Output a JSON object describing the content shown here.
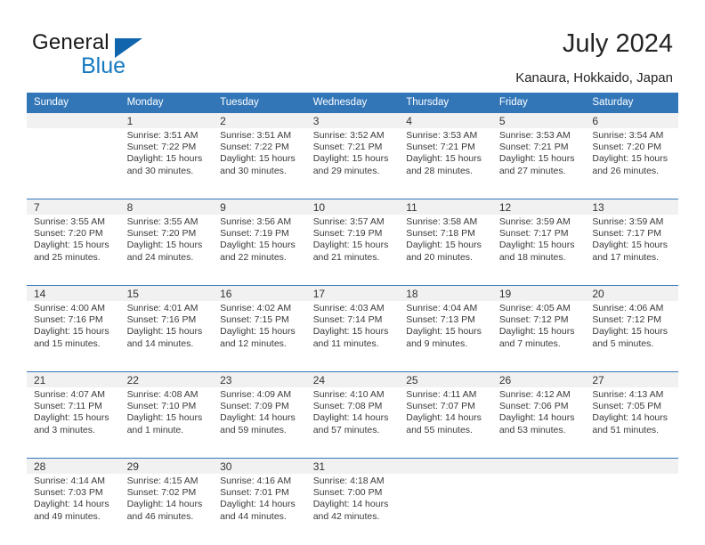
{
  "brand": {
    "name_top": "General",
    "name_bottom": "Blue",
    "accent_color": "#1579c0",
    "triangle_color": "#1165ad"
  },
  "header": {
    "title": "July 2024",
    "subtitle": "Kanaura, Hokkaido, Japan"
  },
  "theme": {
    "header_blue": "#3276b8",
    "daynum_band": "#f1f1f1",
    "text": "#3a3a3a"
  },
  "calendar": {
    "weekday_headers": [
      "Sunday",
      "Monday",
      "Tuesday",
      "Wednesday",
      "Thursday",
      "Friday",
      "Saturday"
    ],
    "weeks": [
      [
        {
          "day": "",
          "info": ""
        },
        {
          "day": "1",
          "info": "Sunrise: 3:51 AM\nSunset: 7:22 PM\nDaylight: 15 hours and 30 minutes."
        },
        {
          "day": "2",
          "info": "Sunrise: 3:51 AM\nSunset: 7:22 PM\nDaylight: 15 hours and 30 minutes."
        },
        {
          "day": "3",
          "info": "Sunrise: 3:52 AM\nSunset: 7:21 PM\nDaylight: 15 hours and 29 minutes."
        },
        {
          "day": "4",
          "info": "Sunrise: 3:53 AM\nSunset: 7:21 PM\nDaylight: 15 hours and 28 minutes."
        },
        {
          "day": "5",
          "info": "Sunrise: 3:53 AM\nSunset: 7:21 PM\nDaylight: 15 hours and 27 minutes."
        },
        {
          "day": "6",
          "info": "Sunrise: 3:54 AM\nSunset: 7:20 PM\nDaylight: 15 hours and 26 minutes."
        }
      ],
      [
        {
          "day": "7",
          "info": "Sunrise: 3:55 AM\nSunset: 7:20 PM\nDaylight: 15 hours and 25 minutes."
        },
        {
          "day": "8",
          "info": "Sunrise: 3:55 AM\nSunset: 7:20 PM\nDaylight: 15 hours and 24 minutes."
        },
        {
          "day": "9",
          "info": "Sunrise: 3:56 AM\nSunset: 7:19 PM\nDaylight: 15 hours and 22 minutes."
        },
        {
          "day": "10",
          "info": "Sunrise: 3:57 AM\nSunset: 7:19 PM\nDaylight: 15 hours and 21 minutes."
        },
        {
          "day": "11",
          "info": "Sunrise: 3:58 AM\nSunset: 7:18 PM\nDaylight: 15 hours and 20 minutes."
        },
        {
          "day": "12",
          "info": "Sunrise: 3:59 AM\nSunset: 7:17 PM\nDaylight: 15 hours and 18 minutes."
        },
        {
          "day": "13",
          "info": "Sunrise: 3:59 AM\nSunset: 7:17 PM\nDaylight: 15 hours and 17 minutes."
        }
      ],
      [
        {
          "day": "14",
          "info": "Sunrise: 4:00 AM\nSunset: 7:16 PM\nDaylight: 15 hours and 15 minutes."
        },
        {
          "day": "15",
          "info": "Sunrise: 4:01 AM\nSunset: 7:16 PM\nDaylight: 15 hours and 14 minutes."
        },
        {
          "day": "16",
          "info": "Sunrise: 4:02 AM\nSunset: 7:15 PM\nDaylight: 15 hours and 12 minutes."
        },
        {
          "day": "17",
          "info": "Sunrise: 4:03 AM\nSunset: 7:14 PM\nDaylight: 15 hours and 11 minutes."
        },
        {
          "day": "18",
          "info": "Sunrise: 4:04 AM\nSunset: 7:13 PM\nDaylight: 15 hours and 9 minutes."
        },
        {
          "day": "19",
          "info": "Sunrise: 4:05 AM\nSunset: 7:12 PM\nDaylight: 15 hours and 7 minutes."
        },
        {
          "day": "20",
          "info": "Sunrise: 4:06 AM\nSunset: 7:12 PM\nDaylight: 15 hours and 5 minutes."
        }
      ],
      [
        {
          "day": "21",
          "info": "Sunrise: 4:07 AM\nSunset: 7:11 PM\nDaylight: 15 hours and 3 minutes."
        },
        {
          "day": "22",
          "info": "Sunrise: 4:08 AM\nSunset: 7:10 PM\nDaylight: 15 hours and 1 minute."
        },
        {
          "day": "23",
          "info": "Sunrise: 4:09 AM\nSunset: 7:09 PM\nDaylight: 14 hours and 59 minutes."
        },
        {
          "day": "24",
          "info": "Sunrise: 4:10 AM\nSunset: 7:08 PM\nDaylight: 14 hours and 57 minutes."
        },
        {
          "day": "25",
          "info": "Sunrise: 4:11 AM\nSunset: 7:07 PM\nDaylight: 14 hours and 55 minutes."
        },
        {
          "day": "26",
          "info": "Sunrise: 4:12 AM\nSunset: 7:06 PM\nDaylight: 14 hours and 53 minutes."
        },
        {
          "day": "27",
          "info": "Sunrise: 4:13 AM\nSunset: 7:05 PM\nDaylight: 14 hours and 51 minutes."
        }
      ],
      [
        {
          "day": "28",
          "info": "Sunrise: 4:14 AM\nSunset: 7:03 PM\nDaylight: 14 hours and 49 minutes."
        },
        {
          "day": "29",
          "info": "Sunrise: 4:15 AM\nSunset: 7:02 PM\nDaylight: 14 hours and 46 minutes."
        },
        {
          "day": "30",
          "info": "Sunrise: 4:16 AM\nSunset: 7:01 PM\nDaylight: 14 hours and 44 minutes."
        },
        {
          "day": "31",
          "info": "Sunrise: 4:18 AM\nSunset: 7:00 PM\nDaylight: 14 hours and 42 minutes."
        },
        {
          "day": "",
          "info": ""
        },
        {
          "day": "",
          "info": ""
        },
        {
          "day": "",
          "info": ""
        }
      ]
    ]
  }
}
